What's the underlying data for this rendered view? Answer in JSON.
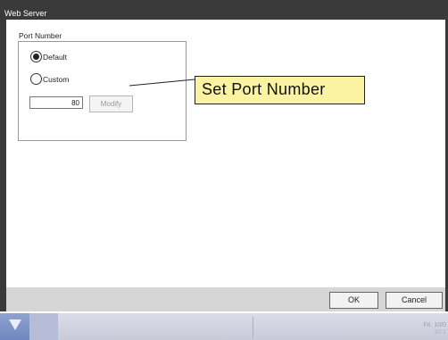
{
  "window": {
    "title": "Web Server"
  },
  "port": {
    "group_label": "Port Number",
    "options": [
      {
        "label": "Default",
        "selected": true
      },
      {
        "label": "Custom",
        "selected": false
      }
    ],
    "value": "80",
    "modify_label": "Modify"
  },
  "callout": {
    "text": "Set Port Number"
  },
  "footer": {
    "ok_label": "OK",
    "cancel_label": "Cancel"
  },
  "taskbar": {
    "clock_line1": "Fri. 10/0",
    "clock_line2": "10:1"
  },
  "colors": {
    "titlebar": "#3a3a3a",
    "callout_bg": "#fbf3a2",
    "footer_bg": "#d6d6d6"
  }
}
